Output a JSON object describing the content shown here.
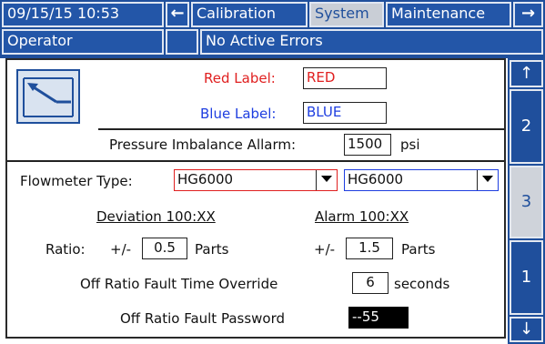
{
  "header": {
    "datetime": "09/15/15 10:53",
    "prev_arrow": "←",
    "tabs": [
      "Calibration",
      "System",
      "Maintenance"
    ],
    "next_arrow": "→"
  },
  "status": {
    "user": "Operator",
    "message": "No Active Errors"
  },
  "labels": {
    "red_label_caption": "Red Label:",
    "red_label_value": "RED",
    "blue_label_caption": "Blue Label:",
    "blue_label_value": "BLUE",
    "pressure_caption": "Pressure Imbalance Allarm:",
    "pressure_value": "1500",
    "pressure_unit": "psi",
    "flowmeter_caption": "Flowmeter Type:",
    "flowmeter_red": "HG6000",
    "flowmeter_blue": "HG6000",
    "deviation_caption": "Deviation 100:XX",
    "alarm_caption": "Alarm 100:XX",
    "ratio_caption": "Ratio:",
    "plusminus1": "+/-",
    "deviation_value": "0.5",
    "deviation_unit": "Parts",
    "plusminus2": "+/-",
    "alarm_value": "1.5",
    "alarm_unit": "Parts",
    "override_caption": "Off Ratio Fault Time Override",
    "override_value": "6",
    "override_unit": "seconds",
    "password_caption": "Off Ratio Fault  Password",
    "password_value": "--55"
  },
  "side_nav": {
    "up": "↑",
    "pages": [
      "2",
      "3",
      "1"
    ],
    "down": "↓"
  },
  "colors": {
    "accent": "#1f4f9c",
    "red": "#e02020",
    "blue": "#1e3ee0"
  }
}
